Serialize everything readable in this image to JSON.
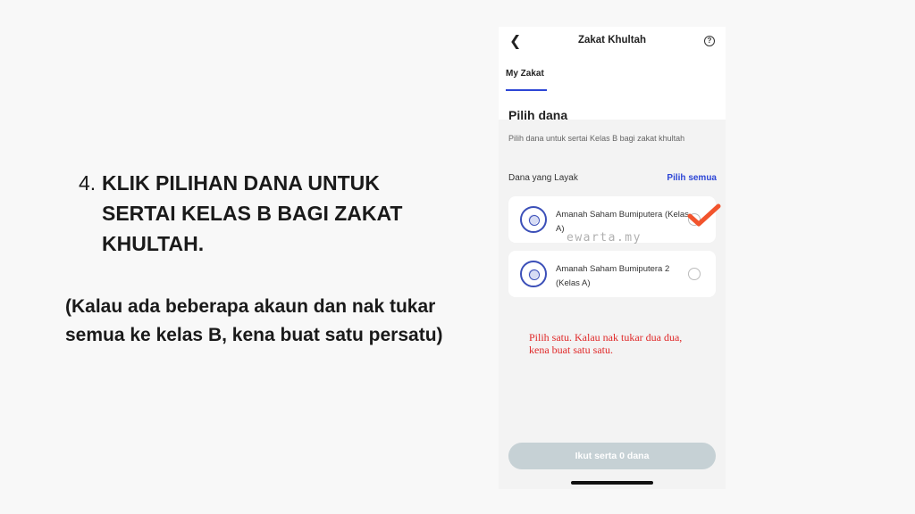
{
  "instruction": {
    "number": "4.",
    "text": "KLIK PILIHAN DANA UNTUK SERTAI KELAS B BAGI ZAKAT KHULTAH.",
    "note": "(Kalau ada beberapa akaun dan nak tukar semua ke kelas B, kena buat satu persatu)"
  },
  "app": {
    "title": "Zakat Khultah",
    "back_icon": "chevron-left-icon",
    "help_icon": "question-circle-icon",
    "help_glyph": "?",
    "tab_label": "My Zakat",
    "accent_color": "#2d46d6",
    "section_title": "Pilih dana",
    "section_desc": "Pilih dana untuk sertai Kelas B bagi zakat khultah",
    "list_label": "Dana yang Layak",
    "select_all": "Pilih semua",
    "funds": [
      {
        "name": "Amanah Saham Bumiputera (Kelas A)",
        "checked": false
      },
      {
        "name": "Amanah Saham Bumiputera 2 (Kelas A)",
        "checked": false
      }
    ],
    "watermark": "ewarta.my",
    "annotation": "Pilih satu. Kalau nak tukar dua dua, kena buat satu satu.",
    "annotation_color": "#e02828",
    "join_button": "Ikut serta 0 dana"
  }
}
